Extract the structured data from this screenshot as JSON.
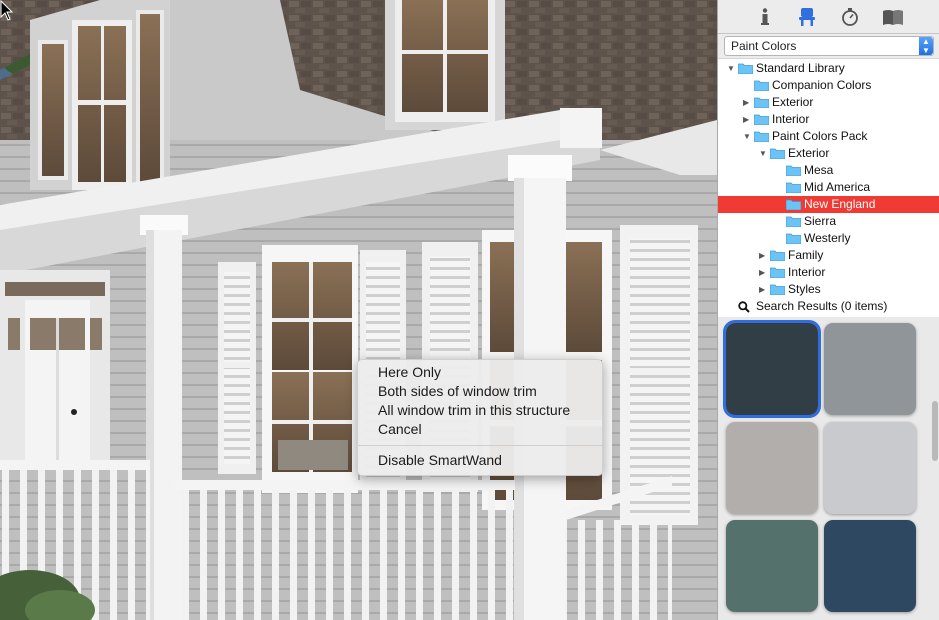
{
  "context_menu": {
    "items": [
      "Here Only",
      "Both sides of window trim",
      "All window trim in this structure",
      "Cancel"
    ],
    "disable": "Disable SmartWand"
  },
  "panel": {
    "tabs": [
      {
        "icon": "info-icon"
      },
      {
        "icon": "chair-icon"
      },
      {
        "icon": "stopwatch-icon"
      },
      {
        "icon": "book-icon"
      }
    ],
    "library_select": "Paint Colors",
    "tree": [
      {
        "label": "Standard Library",
        "expanded": true
      },
      {
        "label": "Companion Colors"
      },
      {
        "label": "Exterior",
        "expanded": false
      },
      {
        "label": "Interior",
        "expanded": false
      },
      {
        "label": "Paint Colors Pack",
        "expanded": true
      },
      {
        "label": "Exterior",
        "expanded": true
      },
      {
        "label": "Mesa"
      },
      {
        "label": "Mid America"
      },
      {
        "label": "New England",
        "selected": true
      },
      {
        "label": "Sierra"
      },
      {
        "label": "Westerly"
      },
      {
        "label": "Family",
        "expanded": false
      },
      {
        "label": "Interior",
        "expanded": false
      },
      {
        "label": "Styles",
        "expanded": false
      }
    ],
    "search_results": "Search Results (0 items)",
    "swatch_colors": [
      "#323e45",
      "#8f9598",
      "#b2aeab",
      "#c9cacd",
      "#55716c",
      "#2f4862"
    ]
  }
}
